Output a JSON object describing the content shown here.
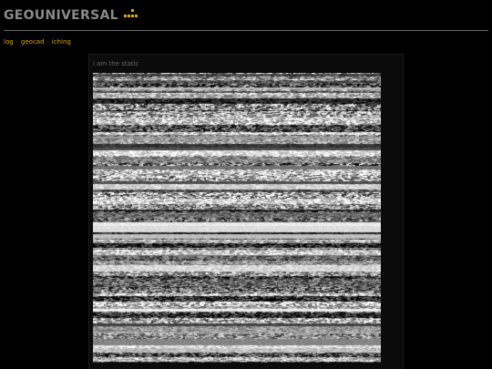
{
  "site": {
    "title": "GEOUNIVERSAL",
    "logo_icon": "dots-logo-icon",
    "accent_color": "#e0a800"
  },
  "nav": {
    "links": [
      {
        "label": "log"
      },
      {
        "label": "geocad"
      },
      {
        "label": "iching"
      }
    ],
    "separator": "·"
  },
  "post": {
    "caption": "i am the static",
    "image": "static-noise-image"
  }
}
